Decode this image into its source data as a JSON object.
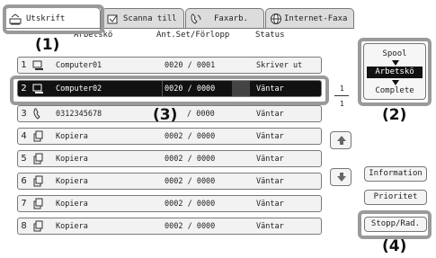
{
  "tabs": [
    {
      "label": "Utskrift",
      "icon": "printer-icon",
      "active": true
    },
    {
      "label": "Scanna till",
      "icon": "scan-icon",
      "active": false
    },
    {
      "label": "Faxarb.",
      "icon": "fax-icon",
      "active": false
    },
    {
      "label": "Internet-Faxa",
      "icon": "globe-icon",
      "active": false
    }
  ],
  "columns": {
    "queue": "Arbetskö",
    "progress": "Ant.Set/Förlopp",
    "status": "Status"
  },
  "jobs": [
    {
      "num": "1",
      "icon": "computer-icon",
      "name": "Computer01",
      "progress": "0020 / 0001",
      "status": "Skriver ut",
      "selected": false
    },
    {
      "num": "2",
      "icon": "computer-icon",
      "name": "Computer02",
      "progress": "0020 / 0000",
      "status": "Väntar",
      "selected": true
    },
    {
      "num": "3",
      "icon": "phone-icon",
      "name": "0312345678",
      "progress": "/ 0000",
      "status": "Väntar",
      "selected": false
    },
    {
      "num": "4",
      "icon": "copy-icon",
      "name": "Kopiera",
      "progress": "0002 / 0000",
      "status": "Väntar",
      "selected": false
    },
    {
      "num": "5",
      "icon": "copy-icon",
      "name": "Kopiera",
      "progress": "0002 / 0000",
      "status": "Väntar",
      "selected": false
    },
    {
      "num": "6",
      "icon": "copy-icon",
      "name": "Kopiera",
      "progress": "0002 / 0000",
      "status": "Väntar",
      "selected": false
    },
    {
      "num": "7",
      "icon": "copy-icon",
      "name": "Kopiera",
      "progress": "0002 / 0000",
      "status": "Väntar",
      "selected": false
    },
    {
      "num": "8",
      "icon": "copy-icon",
      "name": "Kopiera",
      "progress": "0002 / 0000",
      "status": "Väntar",
      "selected": false
    }
  ],
  "page_indicator": {
    "current": "1",
    "total": "1"
  },
  "spool": {
    "label": "Spool",
    "selected": "Arbetskö",
    "complete": "Complete"
  },
  "buttons": {
    "information": "Information",
    "priority": "Prioritet",
    "stop": "Stopp/Rad."
  },
  "callouts": [
    "(1)",
    "(2)",
    "(3)",
    "(4)"
  ],
  "colors": {
    "highlight": "#9a9a9a",
    "selected_row": "#111111"
  }
}
